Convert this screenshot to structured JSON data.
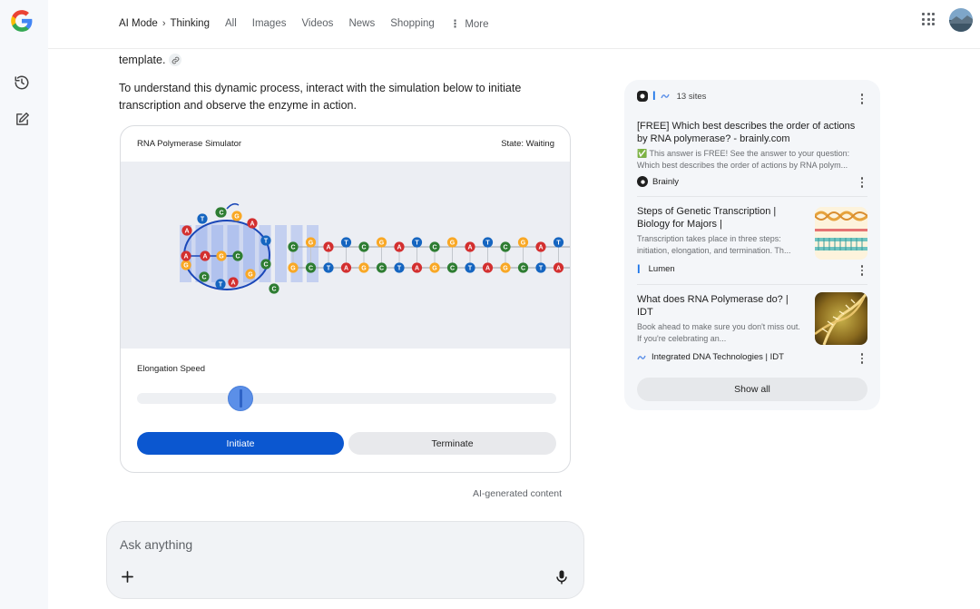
{
  "topbar": {
    "tabs": [
      {
        "label": "AI Mode"
      },
      {
        "label": "Thinking"
      },
      {
        "label": "All"
      },
      {
        "label": "Images"
      },
      {
        "label": "Videos"
      },
      {
        "label": "News"
      },
      {
        "label": "Shopping"
      },
      {
        "label": "More"
      }
    ],
    "breadcrumb_sep": "›"
  },
  "content": {
    "intro_line": "template.",
    "paragraph": "To understand this dynamic process, interact with the simulation below to initiate transcription and observe the enzyme in action.",
    "ai_note": "AI-generated content"
  },
  "simulator": {
    "title": "RNA Polymerase Simulator",
    "state": "State: Waiting",
    "speed_label": "Elongation Speed",
    "speed_value": 0.23,
    "initiate_label": "Initiate",
    "terminate_label": "Terminate",
    "top_strand": [
      "C",
      "G",
      "A",
      "T",
      "C",
      "G",
      "A",
      "T",
      "C",
      "G",
      "A",
      "T",
      "C",
      "G",
      "A",
      "T"
    ],
    "bottom_strand": [
      "G",
      "C",
      "T",
      "A",
      "G",
      "C",
      "T",
      "A",
      "G",
      "C",
      "T",
      "A",
      "G",
      "C",
      "T",
      "A"
    ],
    "bubble_top": [
      "A",
      "T",
      "C",
      "G",
      "A",
      "T",
      "C",
      "G"
    ],
    "bubble_rna": [
      "A",
      "G",
      "C"
    ],
    "colors": {
      "A": "#d32f2f",
      "T": "#1565c0",
      "C": "#2e7d32",
      "G": "#f9a825"
    }
  },
  "ask": {
    "placeholder": "Ask anything"
  },
  "sources": {
    "count_label": "13 sites",
    "items": [
      {
        "title": "[FREE] Which best describes the order of actions by RNA polymerase? - brainly.com",
        "snippet": "✅ This answer is FREE! See the answer to your question: Which best describes the order of actions by RNA polym...",
        "site": "Brainly"
      },
      {
        "title": "Steps of Genetic Transcription | Biology for Majors |",
        "snippet": "Transcription takes place in three steps: initiation, elongation, and termination. Th...",
        "site": "Lumen"
      },
      {
        "title": "What does RNA Polymerase do? | IDT",
        "snippet": "Book ahead to make sure you don't miss out. If you're celebrating an...",
        "site": "Integrated DNA Technologies | IDT"
      }
    ],
    "show_all_label": "Show all"
  }
}
